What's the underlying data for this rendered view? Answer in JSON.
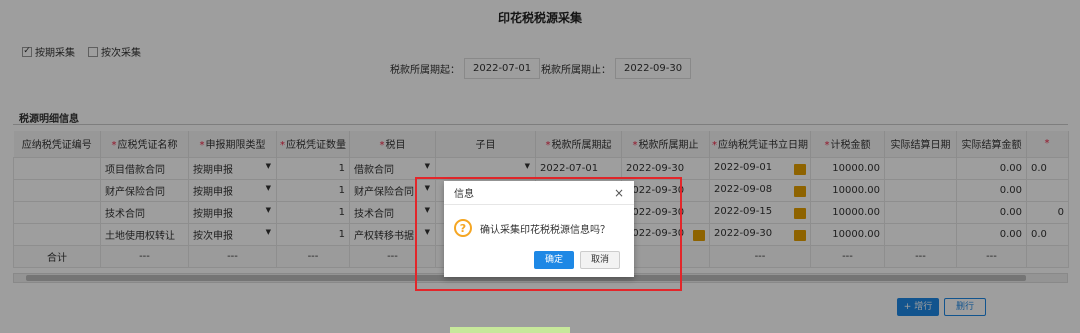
{
  "title": "印花税税源采集",
  "options": {
    "by_period": "按期采集",
    "by_times": "按次采集"
  },
  "period": {
    "start_label": "税款所属期起：",
    "start_value": "2022-07-01",
    "end_label": "税款所属期止：",
    "end_value": "2022-09-30"
  },
  "section_title": "税源明细信息",
  "table": {
    "headers": [
      "应纳税凭证编号",
      "应税凭证名称",
      "申报期限类型",
      "应税凭证数量",
      "税目",
      "子目",
      "税款所属期起",
      "税款所属期止",
      "应纳税凭证书立日期",
      "计税金额",
      "实际结算日期",
      "实际结算金额",
      "*"
    ],
    "rows": [
      {
        "no": "",
        "name": "项目借款合同",
        "type": "按期申报",
        "qty": "1",
        "item": "借款合同",
        "sub": "",
        "start": "2022-07-01",
        "end": "2022-09-30",
        "date": "2022-09-01",
        "amount": "10000.00",
        "settle_date": "",
        "settle_amount": "0.00",
        "extra": "0.0"
      },
      {
        "no": "",
        "name": "财产保险合同",
        "type": "按期申报",
        "qty": "1",
        "item": "财产保险合同",
        "sub": "",
        "start": "",
        "end": "2022-09-30",
        "date": "2022-09-08",
        "amount": "10000.00",
        "settle_date": "",
        "settle_amount": "0.00",
        "extra": ""
      },
      {
        "no": "",
        "name": "技术合同",
        "type": "按期申报",
        "qty": "1",
        "item": "技术合同",
        "sub": "",
        "start": "",
        "end": "2022-09-30",
        "date": "2022-09-15",
        "amount": "10000.00",
        "settle_date": "",
        "settle_amount": "0.00",
        "extra": "0"
      },
      {
        "no": "",
        "name": "土地使用权转让",
        "type": "按次申报",
        "qty": "1",
        "item": "产权转移书据",
        "sub": "",
        "start": "",
        "end": "2022-09-30",
        "date": "2022-09-30",
        "amount": "10000.00",
        "settle_date": "",
        "settle_amount": "0.00",
        "extra": "0.0"
      }
    ],
    "total_label": "合计",
    "dash": "---"
  },
  "buttons": {
    "add_row": "+ 增行",
    "del_row": "删行"
  },
  "dialog": {
    "title": "信息",
    "close": "×",
    "icon": "?",
    "message": "确认采集印花税税源信息吗？",
    "ok": "确定",
    "cancel": "取消"
  },
  "colors": {
    "primary": "#1e88e5",
    "highlight": "#e3262a",
    "warn": "#f5a623"
  }
}
